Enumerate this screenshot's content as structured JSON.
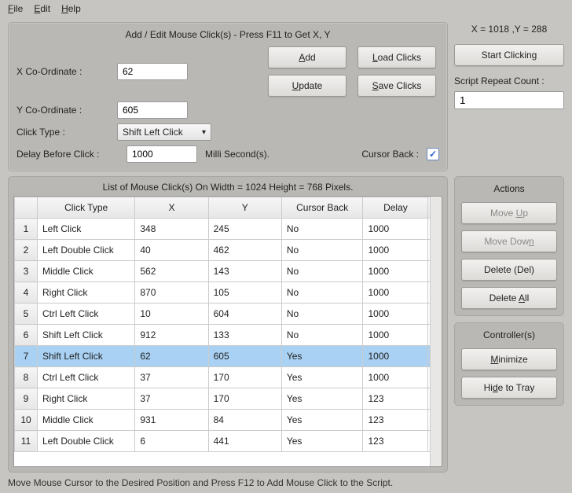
{
  "menu": {
    "file": "File",
    "edit": "Edit",
    "help": "Help"
  },
  "addEdit": {
    "title": "Add / Edit Mouse Click(s) - Press F11 to Get X, Y",
    "xLabel": "X Co-Ordinate :",
    "xValue": "62",
    "yLabel": "Y Co-Ordinate :",
    "yValue": "605",
    "clickTypeLabel": "Click Type :",
    "clickTypeValue": "Shift Left Click",
    "delayLabel": "Delay Before Click :",
    "delayValue": "1000",
    "delayUnit": "Milli Second(s).",
    "cursorBackLabel": "Cursor Back :",
    "cursorBackChecked": "✓",
    "buttons": {
      "add": "Add",
      "update": "Update",
      "load": "Load Clicks",
      "save": "Save Clicks"
    }
  },
  "coords": "X = 1018 ,Y = 288",
  "startBtn": "Start Clicking",
  "repeatLabel": "Script Repeat Count :",
  "repeatValue": "1",
  "table": {
    "title": "List of Mouse Click(s) On Width = 1024 Height = 768 Pixels.",
    "headers": {
      "clickType": "Click Type",
      "x": "X",
      "y": "Y",
      "cursorBack": "Cursor Back",
      "delay": "Delay"
    },
    "rows": [
      {
        "n": "1",
        "type": "Left Click",
        "x": "348",
        "y": "245",
        "cb": "No",
        "d": "1000"
      },
      {
        "n": "2",
        "type": "Left Double Click",
        "x": "40",
        "y": "462",
        "cb": "No",
        "d": "1000"
      },
      {
        "n": "3",
        "type": "Middle Click",
        "x": "562",
        "y": "143",
        "cb": "No",
        "d": "1000"
      },
      {
        "n": "4",
        "type": "Right Click",
        "x": "870",
        "y": "105",
        "cb": "No",
        "d": "1000"
      },
      {
        "n": "5",
        "type": "Ctrl Left Click",
        "x": "10",
        "y": "604",
        "cb": "No",
        "d": "1000"
      },
      {
        "n": "6",
        "type": "Shift Left Click",
        "x": "912",
        "y": "133",
        "cb": "No",
        "d": "1000"
      },
      {
        "n": "7",
        "type": "Shift Left Click",
        "x": "62",
        "y": "605",
        "cb": "Yes",
        "d": "1000"
      },
      {
        "n": "8",
        "type": "Ctrl Left Click",
        "x": "37",
        "y": "170",
        "cb": "Yes",
        "d": "1000"
      },
      {
        "n": "9",
        "type": "Right Click",
        "x": "37",
        "y": "170",
        "cb": "Yes",
        "d": "123"
      },
      {
        "n": "10",
        "type": "Middle Click",
        "x": "931",
        "y": "84",
        "cb": "Yes",
        "d": "123"
      },
      {
        "n": "11",
        "type": "Left Double Click",
        "x": "6",
        "y": "441",
        "cb": "Yes",
        "d": "123"
      }
    ],
    "selectedIndex": 6
  },
  "actions": {
    "title": "Actions",
    "moveUp": "Move Up",
    "moveDown": "Move Down",
    "delete": "Delete (Del)",
    "deleteAll": "Delete All"
  },
  "controllers": {
    "title": "Controller(s)",
    "minimize": "Minimize",
    "hide": "Hide to Tray"
  },
  "statusbar": "Move Mouse Cursor to the Desired Position and Press F12 to Add Mouse Click to the Script."
}
